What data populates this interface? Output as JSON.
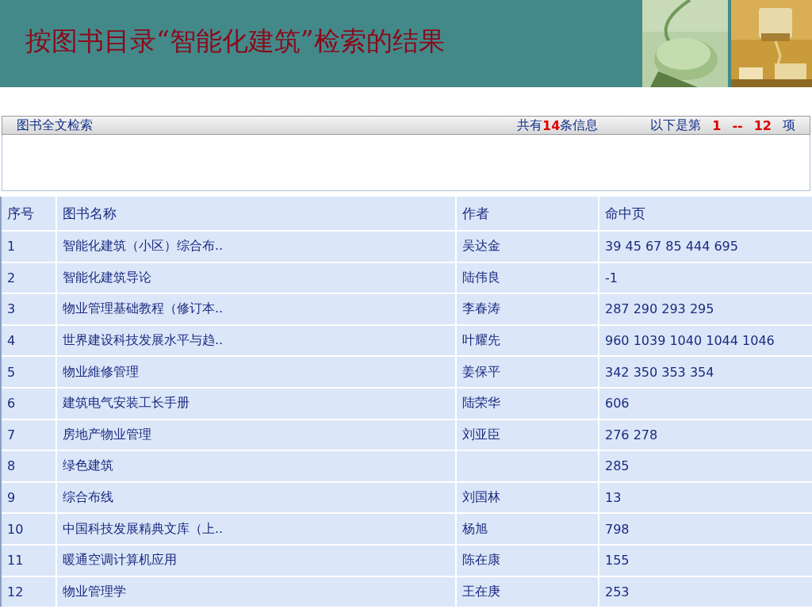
{
  "slide_title": "按图书目录“智能化建筑”检索的结果",
  "search_bar": {
    "label": "图书全文检索",
    "count_before": "共有",
    "count": "14",
    "count_after": "条信息",
    "range_before": "以下是第",
    "range_from": "1",
    "range_sep": "--",
    "range_to": "12",
    "range_after": "项"
  },
  "table": {
    "columns": [
      "序号",
      "图书名称",
      "作者",
      "命中页"
    ],
    "rows": [
      [
        "1",
        "智能化建筑（小区）综合布..",
        "吴达金",
        "39 45 67 85 444 695"
      ],
      [
        "2",
        "智能化建筑导论",
        "陆伟良",
        "-1"
      ],
      [
        "3",
        "物业管理基础教程（修订本..",
        "李春涛",
        "287 290 293 295"
      ],
      [
        "4",
        "世界建设科技发展水平与趋..",
        "叶耀先",
        "960 1039 1040 1044 1046"
      ],
      [
        "5",
        "物业維修管理",
        "姜保平",
        "342 350 353 354"
      ],
      [
        "6",
        "建筑电气安装工长手册",
        "陆荣华",
        "606"
      ],
      [
        "7",
        "房地产物业管理",
        "刘亚臣",
        "276 278"
      ],
      [
        "8",
        "绿色建筑",
        null,
        "285"
      ],
      [
        "9",
        "综合布线",
        "刘国林",
        "13"
      ],
      [
        "10",
        "中国科技发展精典文库（上..",
        "杨旭",
        "798"
      ],
      [
        "11",
        "暖通空调计算机应用",
        "陈在康",
        "155"
      ],
      [
        "12",
        "物业管理学",
        "王在庚",
        "253"
      ]
    ]
  }
}
